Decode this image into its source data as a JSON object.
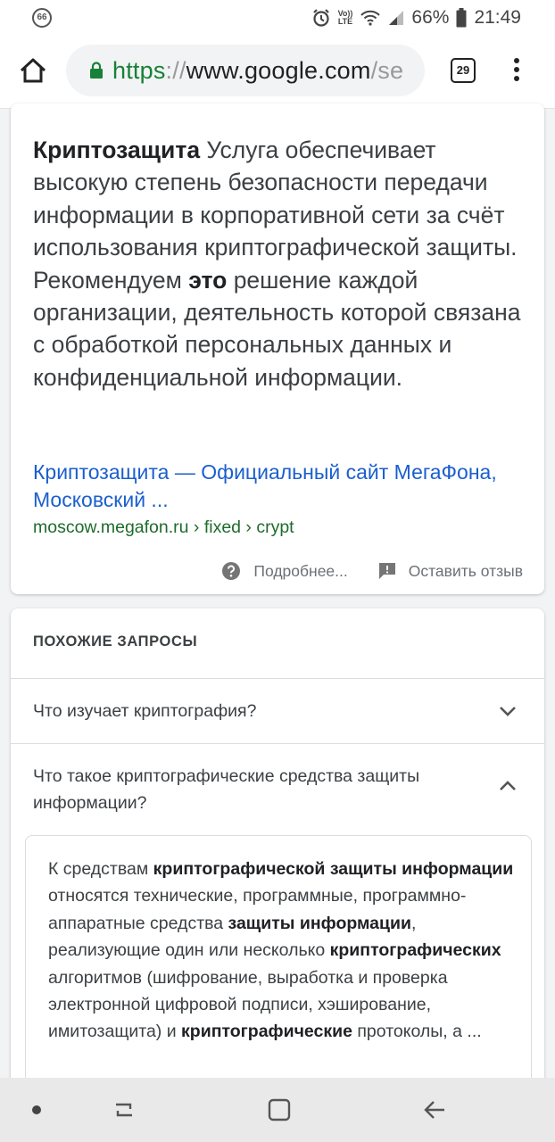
{
  "status_bar": {
    "notification_badge": "66",
    "volte_line1": "Vo))",
    "volte_line2": "LTE",
    "battery_percent": "66%",
    "time": "21:49"
  },
  "toolbar": {
    "url_https": "https",
    "url_sep": "://",
    "url_host": "www.google.com",
    "url_rest": "/se",
    "tab_count": "29"
  },
  "result": {
    "snippet_bold_1": "Криптозащита",
    "snippet_part_1": " Услуга обеспечивает высокую степень безопасности передачи информации в корпоративной сети за счёт использования криптографической защиты. Рекомендуем ",
    "snippet_bold_2": "это",
    "snippet_part_2": " решение каждой организации, деятельность которой связана с обработкой персональных данных и конфиденциальной информации.",
    "title": "Криптозащита — Официальный сайт МегаФона, Московский ...",
    "url": "moscow.megafon.ru › fixed › crypt",
    "more_label": "Подробнее...",
    "feedback_label": "Оставить отзыв"
  },
  "related": {
    "heading": "ПОХОЖИЕ ЗАПРОСЫ",
    "questions": [
      {
        "text": "Что изучает криптография?"
      },
      {
        "text": "Что такое криптографические средства защиты информации?"
      }
    ],
    "answer": {
      "t1": "К средствам ",
      "b1": "криптографической защиты информации",
      "t2": " относятся технические, программные, программно-аппаратные средства ",
      "b2": "защиты информации",
      "t3": ", реализующие один или несколько ",
      "b3": "криптографических",
      "t4": " алгоритмов (шифрование, выработка и проверка электронной цифровой подписи, хэширование, имитозащита) и ",
      "b4": "криптографические",
      "t5": " протоколы, а ..."
    }
  },
  "colors": {
    "link_blue": "#1a5fcd",
    "url_green": "#1e6b2b",
    "https_green": "#188038"
  }
}
